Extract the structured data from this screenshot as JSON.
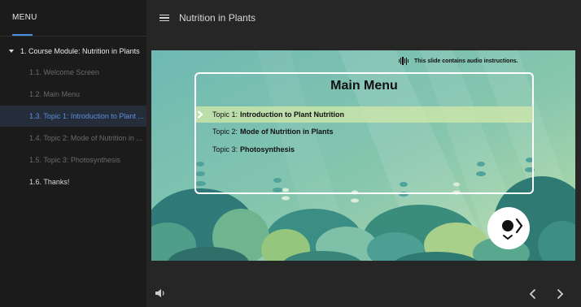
{
  "sidebar": {
    "header": "MENU",
    "module": "1. Course Module: Nutrition in Plants",
    "items": [
      {
        "label": "1.1. Welcome Screen",
        "state": "inactive"
      },
      {
        "label": "1.2. Main Menu",
        "state": "inactive"
      },
      {
        "label": "1.3. Topic 1: Introduction to Plant ...",
        "state": "active"
      },
      {
        "label": "1.4. Topic 2: Mode of Nutrition in ...",
        "state": "inactive"
      },
      {
        "label": "1.5. Topic 3: Photosynthesis",
        "state": "inactive"
      },
      {
        "label": "1.6. Thanks!",
        "state": "done"
      }
    ]
  },
  "header": {
    "menu_icon": "hamburger-icon",
    "title": "Nutrition in Plants"
  },
  "slide": {
    "audio_note": "This slide contains audio instructions.",
    "menu_title": "Main Menu",
    "topics": [
      {
        "prefix": "Topic 1:",
        "name": "Introduction to Plant Nutrition",
        "highlighted": true
      },
      {
        "prefix": "Topic 2:",
        "name": "Mode of Nutrition in Plants",
        "highlighted": false
      },
      {
        "prefix": "Topic 3:",
        "name": "Photosynthesis",
        "highlighted": false
      }
    ],
    "next_icon": "character-next-icon"
  },
  "controls": {
    "volume_icon": "speaker-icon",
    "prev_icon": "chevron-left-icon",
    "next_icon": "chevron-right-icon"
  },
  "colors": {
    "accent": "#4a90e2",
    "active_text": "#5b8fd8",
    "highlight": "#d2e8aa"
  }
}
